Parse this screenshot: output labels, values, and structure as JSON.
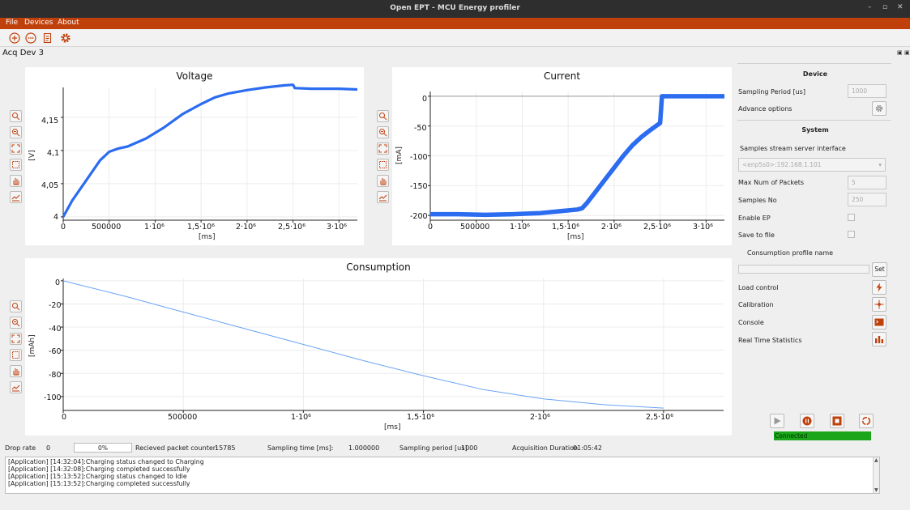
{
  "window": {
    "title": "Open EPT - MCU Energy profiler",
    "controls": [
      "–",
      "▫",
      "✕"
    ]
  },
  "menu": {
    "items": [
      "File",
      "Devices",
      "About"
    ]
  },
  "tab": {
    "title": "Acq Dev 3"
  },
  "toolbar": {
    "icons": [
      "add-icon",
      "dots-icon",
      "document-icon",
      "gear-icon"
    ]
  },
  "colors": {
    "accent": "#c0400c",
    "plot_line": "#2b6cf0",
    "consumption_line": "#6aa3f5",
    "connected": "#1aa51a"
  },
  "voltage_plot": {
    "title": "Voltage",
    "ylabel": "[V]",
    "xlabel": "[ms]",
    "yticks": [
      "4,15",
      "4,1",
      "4,05",
      "4"
    ],
    "xticks": [
      "0",
      "500000",
      "1·10⁶",
      "1,5·10⁶",
      "2·10⁶",
      "2,5·10⁶",
      "3·10⁶"
    ]
  },
  "current_plot": {
    "title": "Current",
    "ylabel": "[mA]",
    "xlabel": "[ms]",
    "yticks": [
      "0",
      "-50",
      "-100",
      "-150",
      "-200"
    ],
    "xticks": [
      "0",
      "500000",
      "1·10⁶",
      "1,5·10⁶",
      "2·10⁶",
      "2,5·10⁶",
      "3·10⁶"
    ]
  },
  "consumption_plot": {
    "title": "Consumption",
    "ylabel": "[mAh]",
    "xlabel": "[ms]",
    "yticks": [
      "0",
      "-20",
      "-40",
      "-60",
      "-80",
      "-100"
    ],
    "xticks": [
      "0",
      "500000",
      "1·10⁶",
      "1,5·10⁶",
      "2·10⁶",
      "2,5·10⁶"
    ]
  },
  "chart_data": [
    {
      "type": "line",
      "title": "Voltage",
      "xlabel": "[ms]",
      "ylabel": "[V]",
      "xlim": [
        0,
        3200000
      ],
      "ylim": [
        3.995,
        4.195
      ],
      "x": [
        0,
        100000,
        250000,
        400000,
        500000,
        600000,
        700000,
        900000,
        1100000,
        1300000,
        1500000,
        1650000,
        1800000,
        2000000,
        2200000,
        2400000,
        2500000,
        2520000,
        2700000,
        3000000,
        3200000
      ],
      "y": [
        4.0,
        4.025,
        4.055,
        4.085,
        4.098,
        4.103,
        4.106,
        4.118,
        4.135,
        4.155,
        4.17,
        4.18,
        4.186,
        4.191,
        4.195,
        4.198,
        4.199,
        4.194,
        4.193,
        4.193,
        4.192
      ]
    },
    {
      "type": "line",
      "title": "Current",
      "xlabel": "[ms]",
      "ylabel": "[mA]",
      "xlim": [
        0,
        3200000
      ],
      "ylim": [
        -208,
        8
      ],
      "x": [
        0,
        300000,
        600000,
        900000,
        1200000,
        1400000,
        1600000,
        1650000,
        1700000,
        1800000,
        1900000,
        2000000,
        2100000,
        2200000,
        2300000,
        2400000,
        2500000,
        2520000,
        2700000,
        3000000,
        3200000
      ],
      "y": [
        -198,
        -198,
        -199,
        -198,
        -196,
        -193,
        -190,
        -188,
        -180,
        -160,
        -140,
        -120,
        -100,
        -82,
        -68,
        -56,
        -45,
        0,
        0,
        0,
        0
      ]
    },
    {
      "type": "line",
      "title": "Consumption",
      "xlabel": "[ms]",
      "ylabel": "[mAh]",
      "xlim": [
        0,
        2750000
      ],
      "ylim": [
        -112,
        2
      ],
      "x": [
        0,
        250000,
        500000,
        750000,
        1000000,
        1250000,
        1500000,
        1750000,
        2000000,
        2250000,
        2500000
      ],
      "y": [
        0,
        -13,
        -27,
        -41,
        -55,
        -69,
        -82,
        -94,
        -102,
        -107,
        -110
      ]
    }
  ],
  "right_panel": {
    "device_header": "Device",
    "sampling_period_label": "Sampling Period [us]",
    "sampling_period_value": "1000",
    "advance_options_label": "Advance options",
    "system_header": "System",
    "stream_label": "Samples stream server interface",
    "stream_value": "<enp5s0>:192.168.1.101",
    "max_packets_label": "Max Num of Packets",
    "max_packets_value": "5",
    "samples_no_label": "Samples No",
    "samples_no_value": "250",
    "enable_ep_label": "Enable EP",
    "save_file_label": "Save to file",
    "profile_name_label": "Consumption profile name",
    "set_label": "Set",
    "load_control_label": "Load control",
    "calibration_label": "Calibration",
    "console_label": "Console",
    "rts_label": "Real Time Statistics",
    "connected_label": "Connected"
  },
  "statusbar": {
    "drop_rate_label": "Drop rate",
    "drop_rate_value": "0",
    "progress_label": "0%",
    "progress_fraction": 0,
    "packet_counter_label": "Recieved packet counter:",
    "packet_counter_value": "15785",
    "sampling_time_label": "Sampling time [ms]:",
    "sampling_time_value": "1.000000",
    "sampling_period_label": "Sampling period [us]",
    "sampling_period_value": "1000",
    "duration_label": "Acquisition Duration",
    "duration_value": "01:05:42"
  },
  "log": [
    "[Application] [14:32:04]:Charging status changed to Charging",
    "[Application] [14:32:08]:Charging completed successfully",
    "[Application] [15:13:52]:Charging status changed to Idle",
    "[Application] [15:13:52]:Charging completed successfully"
  ]
}
